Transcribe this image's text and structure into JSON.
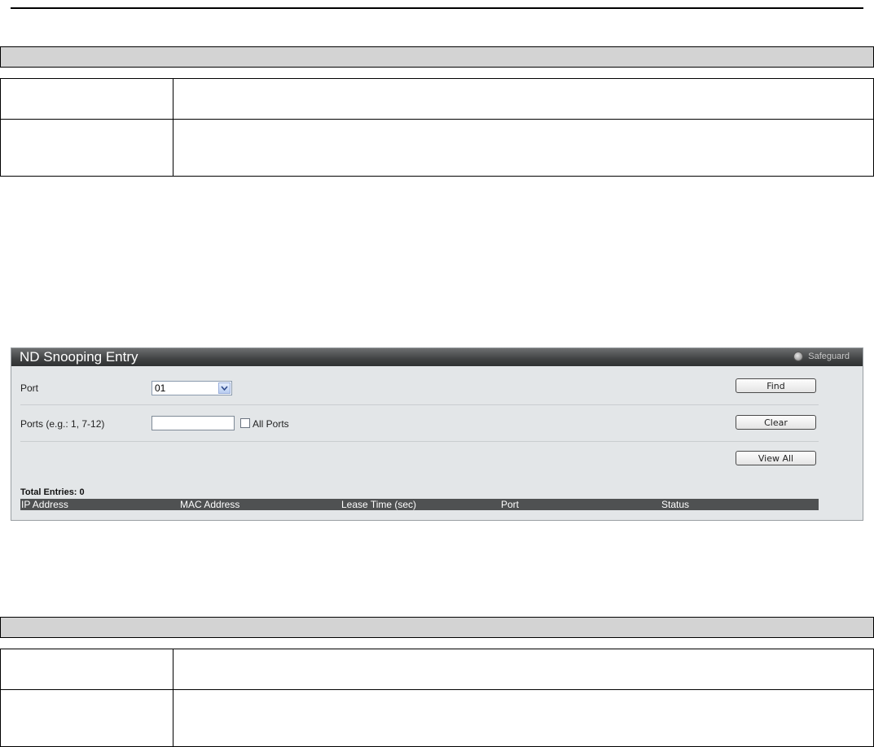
{
  "panel": {
    "title": "ND Snooping Entry",
    "badge_label": "Safeguard",
    "port_label": "Port",
    "port_selected": "01",
    "ports_label": "Ports (e.g.: 1, 7-12)",
    "ports_value": "",
    "all_ports_label": "All Ports",
    "find_label": "Find",
    "clear_label": "Clear",
    "view_all_label": "View All",
    "total_entries": "Total Entries: 0",
    "columns": [
      "IP Address",
      "MAC Address",
      "Lease Time (sec)",
      "Port",
      "Status"
    ]
  }
}
